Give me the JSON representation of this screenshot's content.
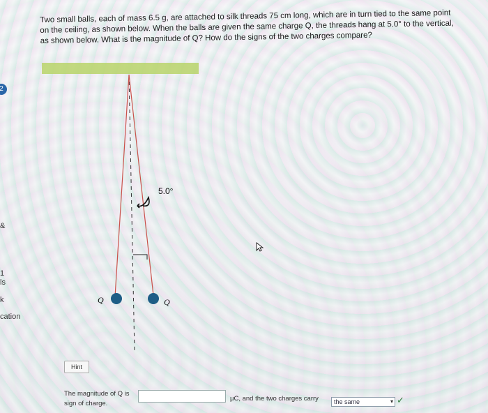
{
  "sidebar": {
    "badge": "2",
    "items": [
      {
        "label": "&"
      },
      {
        "label": "1"
      },
      {
        "label": "ls"
      },
      {
        "label": "k"
      },
      {
        "label": "cation"
      }
    ]
  },
  "question": {
    "text": "Two small balls, each of mass 6.5 g, are attached to silk threads 75 cm long, which are in turn tied to the same point on the ceiling, as shown below. When the balls are given the same charge Q, the threads hang at 5.0° to the vertical, as shown below. What is the magnitude of Q? How do the signs of the two charges compare?"
  },
  "diagram": {
    "angle_label": "5.0°",
    "charge_left": "Q",
    "charge_right": "Q",
    "ceiling_color": "#b9d46a",
    "thread_color": "#c9514a",
    "ball_color": "#1d5d86"
  },
  "hint": {
    "label": "Hint"
  },
  "answer": {
    "label": "The magnitude of Q is",
    "label2": "sign of charge.",
    "input_value": "",
    "unit_text": "μC, and the two charges carry",
    "select_value": "the same"
  }
}
